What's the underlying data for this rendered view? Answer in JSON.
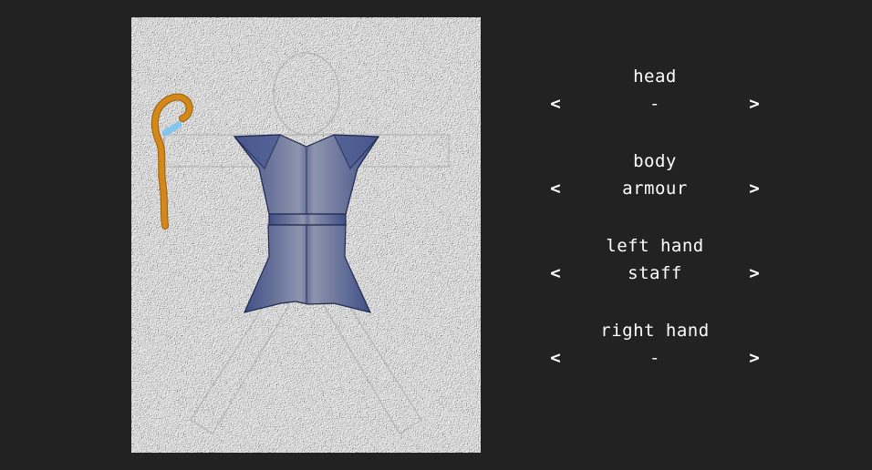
{
  "slots": [
    {
      "name": "head",
      "value": "-",
      "prev_label": "<",
      "next_label": ">"
    },
    {
      "name": "body",
      "value": "armour",
      "prev_label": "<",
      "next_label": ">"
    },
    {
      "name": "left hand",
      "value": "staff",
      "prev_label": "<",
      "next_label": ">"
    },
    {
      "name": "right hand",
      "value": "-",
      "prev_label": "<",
      "next_label": ">"
    }
  ],
  "colors": {
    "background": "#222222",
    "canvas": "#ececec",
    "figure_outline": "#b4b4b4",
    "armour": "#5a6a9e",
    "staff": "#d4881a",
    "staff_gem": "#7cc4f0"
  },
  "equipped_icons": [
    "armour-icon",
    "staff-icon"
  ]
}
